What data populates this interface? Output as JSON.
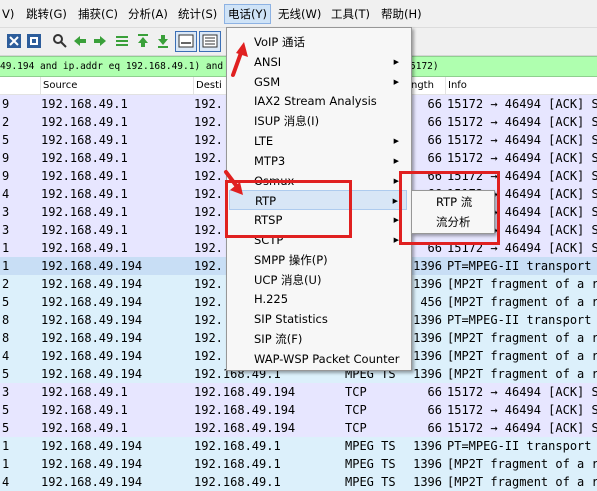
{
  "menubar": {
    "items": [
      {
        "label": "V)"
      },
      {
        "label": "跳转(G)"
      },
      {
        "label": "捕获(C)"
      },
      {
        "label": "分析(A)"
      },
      {
        "label": "统计(S)"
      },
      {
        "label": "电话(Y)"
      },
      {
        "label": "无线(W)"
      },
      {
        "label": "工具(T)"
      },
      {
        "label": "帮助(H)"
      }
    ]
  },
  "filter": {
    "left_text": "49.194 and ip.addr eq 192.168.49.1) and (",
    "right_text": "5172)"
  },
  "columns": {
    "no": "",
    "source": "Source",
    "destination": "Desti",
    "protocol": "",
    "length": "ngth",
    "info": "Info"
  },
  "rows": [
    {
      "no": "9",
      "source": "192.168.49.1",
      "destination": "192.",
      "protocol": "",
      "length": "66",
      "info": "15172 → 46494 [ACK] S"
    },
    {
      "no": "2",
      "source": "192.168.49.1",
      "destination": "192.",
      "protocol": "",
      "length": "66",
      "info": "15172 → 46494 [ACK] S"
    },
    {
      "no": "5",
      "source": "192.168.49.1",
      "destination": "192.",
      "protocol": "",
      "length": "66",
      "info": "15172 → 46494 [ACK] S"
    },
    {
      "no": "9",
      "source": "192.168.49.1",
      "destination": "192.",
      "protocol": "",
      "length": "66",
      "info": "15172 → 46494 [ACK] S"
    },
    {
      "no": "9",
      "source": "192.168.49.1",
      "destination": "192.",
      "protocol": "",
      "length": "66",
      "info": "15172 → 46494 [ACK] S"
    },
    {
      "no": "4",
      "source": "192.168.49.1",
      "destination": "192.",
      "protocol": "",
      "length": "66",
      "info": "15172 → 46494 [ACK] S"
    },
    {
      "no": "3",
      "source": "192.168.49.1",
      "destination": "192.",
      "protocol": "",
      "length": "66",
      "info": "15172 → 46494 [ACK] S"
    },
    {
      "no": "3",
      "source": "192.168.49.1",
      "destination": "192.",
      "protocol": "",
      "length": "66",
      "info": "15172 → 46494 [ACK] S"
    },
    {
      "no": "1",
      "source": "192.168.49.1",
      "destination": "192.",
      "protocol": "",
      "length": "66",
      "info": "15172 → 46494 [ACK] S"
    },
    {
      "no": "1",
      "source": "192.168.49.194",
      "destination": "192.",
      "protocol": "",
      "length": "1396",
      "info": "PT=MPEG-II transport"
    },
    {
      "no": "2",
      "source": "192.168.49.194",
      "destination": "192.",
      "protocol": "",
      "length": "1396",
      "info": "[MP2T fragment of a r"
    },
    {
      "no": "5",
      "source": "192.168.49.194",
      "destination": "192.",
      "protocol": "",
      "length": "456",
      "info": "[MP2T fragment of a r"
    },
    {
      "no": "8",
      "source": "192.168.49.194",
      "destination": "192.",
      "protocol": "",
      "length": "1396",
      "info": "PT=MPEG-II transport"
    },
    {
      "no": "8",
      "source": "192.168.49.194",
      "destination": "192.",
      "protocol": "",
      "length": "1396",
      "info": "[MP2T fragment of a r"
    },
    {
      "no": "4",
      "source": "192.168.49.194",
      "destination": "192.",
      "protocol": "",
      "length": "1396",
      "info": "[MP2T fragment of a r"
    },
    {
      "no": "5",
      "source": "192.168.49.194",
      "destination": "192.168.49.1",
      "protocol": "MPEG TS",
      "length": "1396",
      "info": "[MP2T fragment of a r"
    },
    {
      "no": "3",
      "source": "192.168.49.1",
      "destination": "192.168.49.194",
      "protocol": "TCP",
      "length": "66",
      "info": "15172 → 46494 [ACK] S"
    },
    {
      "no": "5",
      "source": "192.168.49.1",
      "destination": "192.168.49.194",
      "protocol": "TCP",
      "length": "66",
      "info": "15172 → 46494 [ACK] S"
    },
    {
      "no": "5",
      "source": "192.168.49.1",
      "destination": "192.168.49.194",
      "protocol": "TCP",
      "length": "66",
      "info": "15172 → 46494 [ACK] S"
    },
    {
      "no": "1",
      "source": "192.168.49.194",
      "destination": "192.168.49.1",
      "protocol": "MPEG TS",
      "length": "1396",
      "info": "PT=MPEG-II transport"
    },
    {
      "no": "1",
      "source": "192.168.49.194",
      "destination": "192.168.49.1",
      "protocol": "MPEG TS",
      "length": "1396",
      "info": "[MP2T fragment of a r"
    },
    {
      "no": "4",
      "source": "192.168.49.194",
      "destination": "192.168.49.1",
      "protocol": "MPEG TS",
      "length": "1396",
      "info": "[MP2T fragment of a r"
    }
  ],
  "phone_menu": {
    "items": [
      {
        "label": "VoIP 通话",
        "submenu": false
      },
      {
        "label": "ANSI",
        "submenu": true
      },
      {
        "label": "GSM",
        "submenu": true
      },
      {
        "label": "IAX2 Stream Analysis",
        "submenu": false
      },
      {
        "label": "ISUP 消息(I)",
        "submenu": false
      },
      {
        "label": "LTE",
        "submenu": true
      },
      {
        "label": "MTP3",
        "submenu": true
      },
      {
        "label": "Osmux",
        "submenu": true
      },
      {
        "label": "RTP",
        "submenu": true
      },
      {
        "label": "RTSP",
        "submenu": true
      },
      {
        "label": "SCTP",
        "submenu": true
      },
      {
        "label": "SMPP 操作(P)",
        "submenu": false
      },
      {
        "label": "UCP 消息(U)",
        "submenu": false
      },
      {
        "label": "H.225",
        "submenu": false
      },
      {
        "label": "SIP Statistics",
        "submenu": false
      },
      {
        "label": "SIP 流(F)",
        "submenu": false
      },
      {
        "label": "WAP-WSP Packet Counter",
        "submenu": false
      }
    ],
    "arrow_glyph": "▶"
  },
  "rtp_submenu": {
    "items": [
      {
        "label": "RTP 流"
      },
      {
        "label": "流分析"
      }
    ]
  },
  "colors": {
    "filter_bg": "#afffaf",
    "tcp_row": "#e7e6ff",
    "mpeg_row": "#dcf0fb",
    "annotation_red": "#e02020"
  }
}
